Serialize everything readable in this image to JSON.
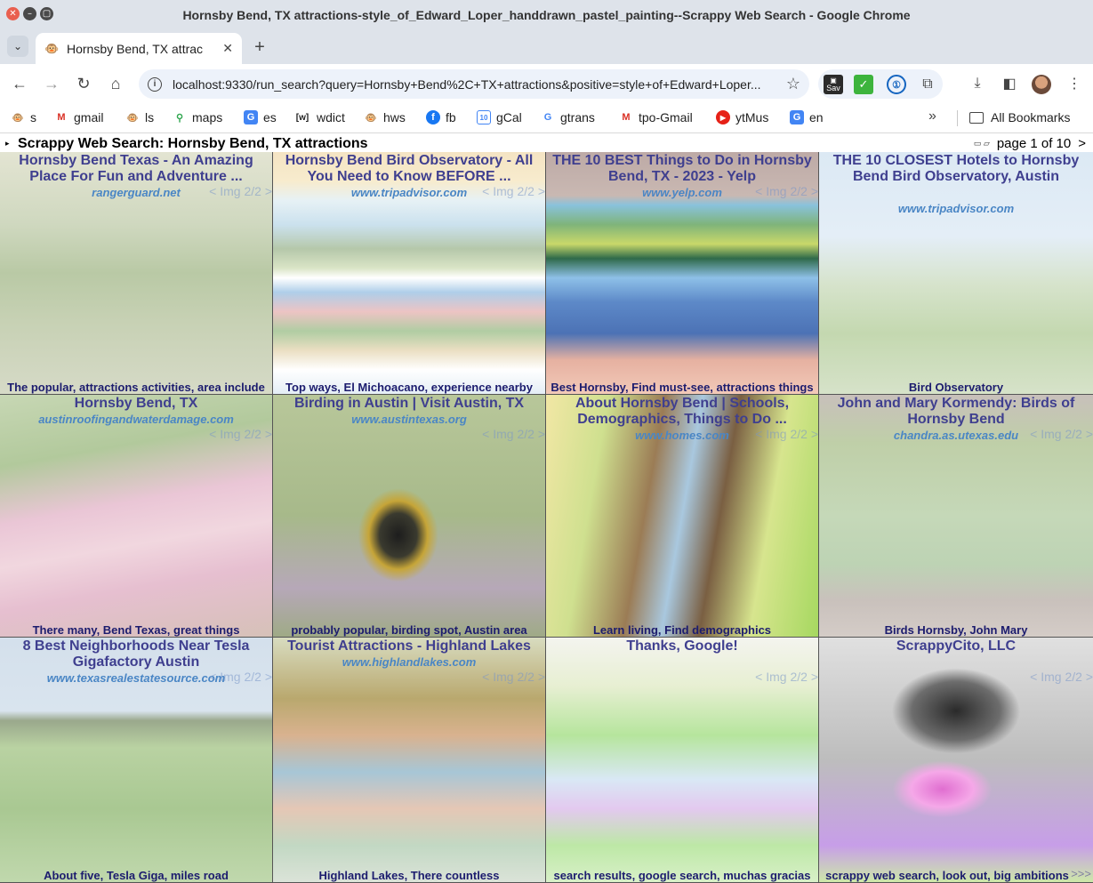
{
  "window": {
    "title": "Hornsby Bend, TX attractions-style_of_Edward_Loper_handdrawn_pastel_painting--Scrappy Web Search - Google Chrome",
    "close_glyph": "✕",
    "min_glyph": "–",
    "max_glyph": "▢"
  },
  "tabs": {
    "list_glyph": "⌄",
    "active_title": "Hornsby Bend, TX attrac",
    "close_glyph": "✕",
    "new_tab_glyph": "+"
  },
  "toolbar": {
    "back_glyph": "←",
    "forward_glyph": "→",
    "reload_glyph": "↻",
    "home_glyph": "⌂",
    "url": "localhost:9330/run_search?query=Hornsby+Bend%2C+TX+attractions&positive=style+of+Edward+Loper...",
    "info_glyph": "i",
    "star_glyph": "☆",
    "ext_save_label": "Sav",
    "ext_check_glyph": "✓",
    "ext_pw_glyph": "①",
    "ext_puzzle_glyph": "⧉",
    "download_glyph": "⤓",
    "sidepanel_glyph": "◧",
    "menu_glyph": "⋮"
  },
  "bookmarks": {
    "items": [
      {
        "label": "s",
        "icon": "🐵",
        "icon_color": "#8a6a3a"
      },
      {
        "label": "gmail",
        "icon": "M",
        "icon_color": "#d93025"
      },
      {
        "label": "ls",
        "icon": "🐵",
        "icon_color": "#8a6a3a"
      },
      {
        "label": "maps",
        "icon": "⚲",
        "icon_color": "#34a853"
      },
      {
        "label": "es",
        "icon": "G",
        "icon_color": "#4285f4"
      },
      {
        "label": "wdict",
        "icon": "[w]",
        "icon_color": "#333333"
      },
      {
        "label": "hws",
        "icon": "🐵",
        "icon_color": "#8a6a3a"
      },
      {
        "label": "fb",
        "icon": "f",
        "icon_color": "#1877f2"
      },
      {
        "label": "gCal",
        "icon": "10",
        "icon_color": "#4285f4"
      },
      {
        "label": "gtrans",
        "icon": "G",
        "icon_color": "#4285f4"
      },
      {
        "label": "tpo-Gmail",
        "icon": "M",
        "icon_color": "#d93025"
      },
      {
        "label": "ytMus",
        "icon": "▶",
        "icon_color": "#e62117"
      },
      {
        "label": "en",
        "icon": "G",
        "icon_color": "#4285f4"
      }
    ],
    "more_glyph": "»",
    "all_bookmarks_label": "All Bookmarks"
  },
  "page": {
    "disclosure_glyph": "▸",
    "title": "Scrappy Web Search: Hornsby Bend, TX attractions",
    "pager_icons": "▭ ▱",
    "pager_text": "page 1 of 10",
    "pager_next": ">"
  },
  "results": [
    {
      "title": "Hornsby Bend Texas - An Amazing Place For Fun and Adventure ...",
      "domain": "rangerguard.net",
      "img_nav": "< Img 2/2 >",
      "snippet": "The popular, attractions activities, area include"
    },
    {
      "title": "Hornsby Bend Bird Observatory - All You Need to Know BEFORE ...",
      "domain": "www.tripadvisor.com",
      "img_nav": "< Img 2/2 >",
      "snippet": "Top ways, El Michoacano, experience nearby"
    },
    {
      "title": "THE 10 BEST Things to Do in Hornsby Bend, TX - 2023 - Yelp",
      "domain": "www.yelp.com",
      "img_nav": "< Img 2/2 >",
      "snippet": "Best Hornsby, Find must-see, attractions things"
    },
    {
      "title": "THE 10 CLOSEST Hotels to Hornsby Bend Bird Observatory, Austin",
      "domain": "www.tripadvisor.com",
      "img_nav": "",
      "snippet": "Bird Observatory"
    },
    {
      "title": "Hornsby Bend, TX",
      "domain": "austinroofingandwaterdamage.com",
      "img_nav": "< Img 2/2 >",
      "snippet": "There many, Bend Texas, great things"
    },
    {
      "title": "Birding in Austin | Visit Austin, TX",
      "domain": "www.austintexas.org",
      "img_nav": "< Img 2/2 >",
      "snippet": "probably popular, birding spot, Austin area"
    },
    {
      "title": "About Hornsby Bend | Schools, Demographics, Things to Do ...",
      "domain": "www.homes.com",
      "img_nav": "< Img 2/2 >",
      "snippet": "Learn living, Find demographics"
    },
    {
      "title": "John and Mary Kormendy: Birds of Hornsby Bend",
      "domain": "chandra.as.utexas.edu",
      "img_nav": "< Img 2/2 >",
      "snippet": "Birds Hornsby, John Mary"
    },
    {
      "title": "8 Best Neighborhoods Near Tesla Gigafactory Austin",
      "domain": "www.texasrealestatesource.com",
      "img_nav": "< Img 2/2 >",
      "snippet": "About five, Tesla Giga, miles road"
    },
    {
      "title": "Tourist Attractions - Highland Lakes",
      "domain": "www.highlandlakes.com",
      "img_nav": "< Img 2/2 >",
      "snippet": "Highland Lakes, There countless"
    },
    {
      "title": "Thanks, Google!",
      "domain": "",
      "img_nav": "< Img 2/2 >",
      "snippet": "search results, google search, muchas gracias"
    },
    {
      "title": "ScrappyCito, LLC",
      "domain": "",
      "img_nav": "< Img 2/2 >",
      "snippet": "scrappy web search, look out, big ambitions"
    }
  ],
  "next_page_glyph": ">>>"
}
